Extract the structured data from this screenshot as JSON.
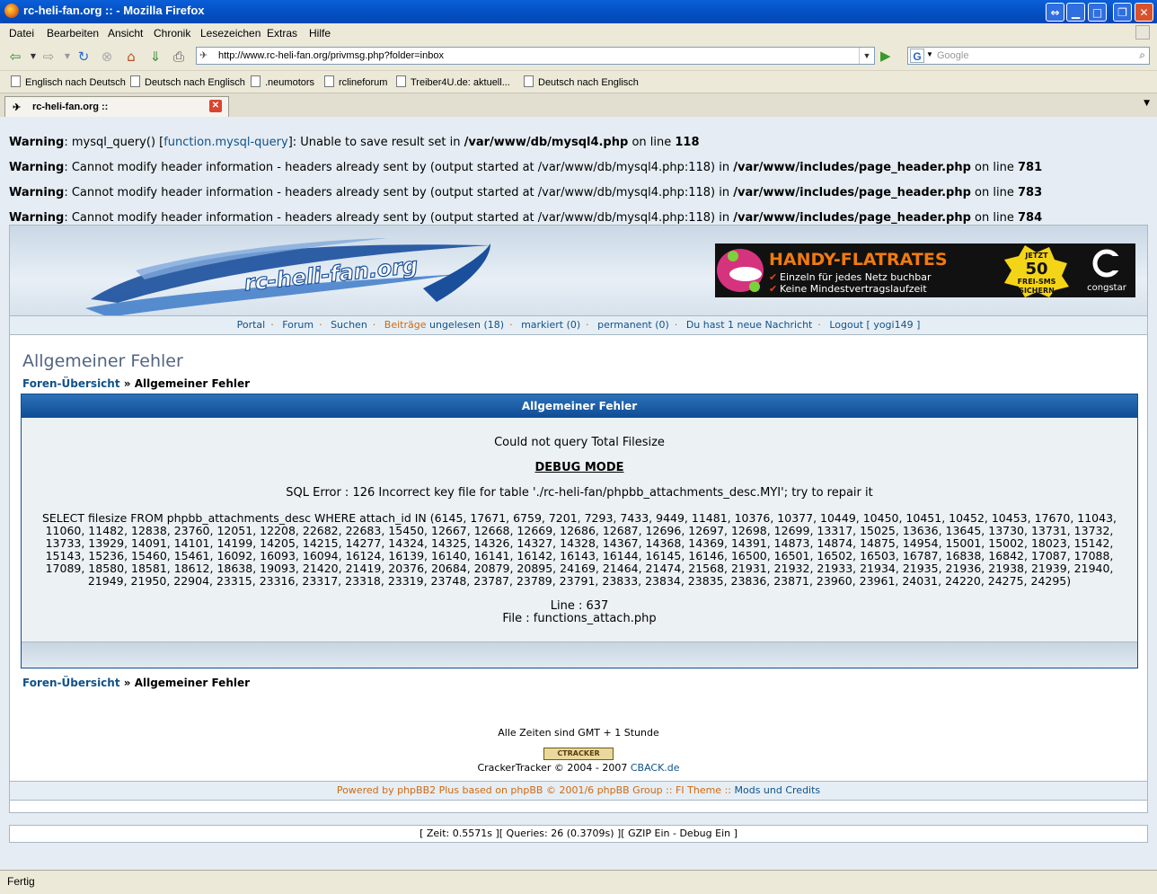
{
  "window": {
    "title": "rc-heli-fan.org :: - Mozilla Firefox"
  },
  "menu": [
    "Datei",
    "Bearbeiten",
    "Ansicht",
    "Chronik",
    "Lesezeichen",
    "Extras",
    "Hilfe"
  ],
  "address": {
    "url": "http://www.rc-heli-fan.org/privmsg.php?folder=inbox"
  },
  "search": {
    "placeholder": "Google"
  },
  "bookmarks": [
    "Englisch nach Deutsch",
    "Deutsch nach Englisch",
    ".neumotors",
    "rclineforum",
    "Treiber4U.de: aktuell...",
    "Deutsch nach Englisch"
  ],
  "tab": {
    "label": "rc-heli-fan.org ::"
  },
  "warnings": [
    {
      "label": "Warning",
      "pre": ": mysql_query() [",
      "link": "function.mysql-query",
      "post": "]: Unable to save result set in ",
      "file": "/var/www/db/mysql4.php",
      "online": " on line ",
      "line": "118"
    },
    {
      "label": "Warning",
      "pre": ": Cannot modify header information - headers already sent by (output started at /var/www/db/mysql4.php:118) in ",
      "link": "",
      "post": "",
      "file": "/var/www/includes/page_header.php",
      "online": " on line ",
      "line": "781"
    },
    {
      "label": "Warning",
      "pre": ": Cannot modify header information - headers already sent by (output started at /var/www/db/mysql4.php:118) in ",
      "link": "",
      "post": "",
      "file": "/var/www/includes/page_header.php",
      "online": " on line ",
      "line": "783"
    },
    {
      "label": "Warning",
      "pre": ": Cannot modify header information - headers already sent by (output started at /var/www/db/mysql4.php:118) in ",
      "link": "",
      "post": "",
      "file": "/var/www/includes/page_header.php",
      "online": " on line ",
      "line": "784"
    }
  ],
  "logo": {
    "text": "rc-heli-fan.org"
  },
  "banner": {
    "headline": "HANDY-FLATRATES",
    "line1": "Einzeln für jedes Netz buchbar",
    "line2": "Keine Mindestvertragslaufzeit",
    "badge_top": "JETZT",
    "badge_num": "50",
    "badge_mid": "FREI-SMS",
    "badge_bot": "SICHERN",
    "brand": "congstar"
  },
  "navlinks": {
    "portal": "Portal",
    "forum": "Forum",
    "suchen": "Suchen",
    "beitraege": "Beiträge",
    "ungelesen": "ungelesen (18)",
    "markiert": "markiert (0)",
    "permanent": "permanent (0)",
    "nachricht": "Du hast 1 neue Nachricht",
    "logout": "Logout [ yogi149 ]"
  },
  "page": {
    "title": "Allgemeiner Fehler",
    "crumb_link": "Foren-Übersicht",
    "crumb_sep": " » ",
    "crumb_current": "Allgemeiner Fehler"
  },
  "panel": {
    "header": "Allgemeiner Fehler",
    "message": "Could not query Total Filesize",
    "debug": "DEBUG MODE",
    "sql_error": "SQL Error : 126 Incorrect key file for table './rc-heli-fan/phpbb_attachments_desc.MYI'; try to repair it",
    "query_lines": [
      "SELECT filesize FROM phpbb_attachments_desc WHERE attach_id IN (6145, 17671, 6759, 7201, 7293, 7433, 9449, 11481, 10376, 10377, 10449, 10450, 10451, 10452, 10453, 17670, 11043,",
      "11060, 11482, 12838, 23760, 12051, 12208, 22682, 22683, 15450, 12667, 12668, 12669, 12686, 12687, 12696, 12697, 12698, 12699, 13317, 15025, 13636, 13645, 13730, 13731, 13732,",
      "13733, 13929, 14091, 14101, 14199, 14205, 14215, 14277, 14324, 14325, 14326, 14327, 14328, 14367, 14368, 14369, 14391, 14873, 14874, 14875, 14954, 15001, 15002, 18023, 15142,",
      "15143, 15236, 15460, 15461, 16092, 16093, 16094, 16124, 16139, 16140, 16141, 16142, 16143, 16144, 16145, 16146, 16500, 16501, 16502, 16503, 16787, 16838, 16842, 17087, 17088,",
      "17089, 18580, 18581, 18612, 18638, 19093, 21420, 21419, 20376, 20684, 20879, 20895, 24169, 21464, 21474, 21568, 21931, 21932, 21933, 21934, 21935, 21936, 21938, 21939, 21940,",
      "21949, 21950, 22904, 23315, 23316, 23317, 23318, 23319, 23748, 23787, 23789, 23791, 23833, 23834, 23835, 23836, 23871, 23960, 23961, 24031, 24220, 24275, 24295)"
    ],
    "line": "Line : 637",
    "file": "File : functions_attach.php"
  },
  "footer": {
    "timezone": "Alle Zeiten sind GMT + 1 Stunde",
    "tracker_badge": "CTRACKER",
    "tracker_text": "CrackerTracker © 2004 - 2007 ",
    "tracker_link": "CBACK.de",
    "powered_pre": "Powered by ",
    "powered_link1": "phpBB2 Plus",
    "powered_mid1": " based on ",
    "powered_link2": "phpBB",
    "powered_mid2": " © 2001/6 phpBB Group :: FI Theme :: ",
    "powered_link3": "Mods und Credits",
    "debug": "[ Zeit: 0.5571s ][ Queries: 26 (0.3709s) ][ GZIP Ein - Debug Ein ]"
  },
  "status": {
    "text": "Fertig"
  },
  "colors": {
    "link": "#105289",
    "accent_orange": "#d06a10",
    "panel_head": "#0e4c95",
    "title": "#536482"
  }
}
